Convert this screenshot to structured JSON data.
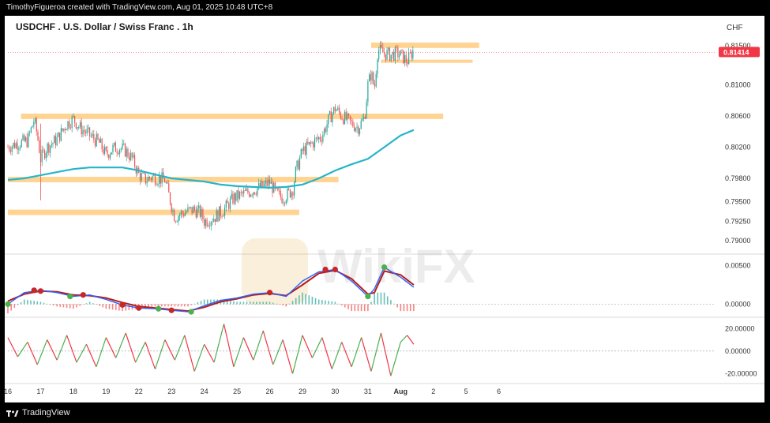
{
  "header": {
    "caption": "TimothyFigueroa created with TradingView.com, Aug 01, 2025 10:48 UTC+8"
  },
  "footer": {
    "brand": "TradingView"
  },
  "watermark": {
    "text": "WikiFX"
  },
  "colors": {
    "background": "#ffffff",
    "up_candle": "#26a69a",
    "down_candle": "#ef5350",
    "ma_line": "#26b5c8",
    "zone_fill": "#ffcc80",
    "price_badge": "#f23645",
    "macd_line": "#2962ff",
    "signal_line": "#b71c1c",
    "macd_cross_up_dot": "#4caf50",
    "macd_cross_down_dot": "#c62828",
    "oscillator_up": "#4caf50",
    "oscillator_down": "#f23645"
  },
  "chart_data": {
    "type": "candlestick",
    "title": "USDCHF . U.S. Dollar / Swiss Franc . 1h",
    "currency": "CHF",
    "last_price": "0.81414",
    "price_axis": {
      "range": [
        0.7885,
        0.8162
      ],
      "ticks": [
        "0.81500",
        "0.81000",
        "0.80600",
        "0.80200",
        "0.79800",
        "0.79500",
        "0.79250",
        "0.79000"
      ]
    },
    "macd_axis": {
      "range": [
        -0.0015,
        0.0065
      ],
      "ticks": [
        "0.00500",
        "0.00000"
      ]
    },
    "oscillator_axis": {
      "range": [
        -26,
        30
      ],
      "ticks": [
        "20.00000",
        "0.00000",
        "-20.00000"
      ]
    },
    "x_axis": {
      "day_range": [
        16,
        37.5
      ],
      "ticks": [
        {
          "label": "16",
          "day": 16
        },
        {
          "label": "17",
          "day": 17
        },
        {
          "label": "18",
          "day": 18
        },
        {
          "label": "19",
          "day": 19
        },
        {
          "label": "22",
          "day": 20
        },
        {
          "label": "23",
          "day": 21
        },
        {
          "label": "24",
          "day": 22
        },
        {
          "label": "25",
          "day": 23
        },
        {
          "label": "26",
          "day": 24
        },
        {
          "label": "29",
          "day": 25
        },
        {
          "label": "30",
          "day": 26
        },
        {
          "label": "31",
          "day": 27
        },
        {
          "label": "Aug",
          "day": 28
        },
        {
          "label": "2",
          "day": 29
        },
        {
          "label": "5",
          "day": 30
        },
        {
          "label": "6",
          "day": 31
        }
      ]
    },
    "price_path": [
      [
        16.0,
        0.802
      ],
      [
        16.3,
        0.8025
      ],
      [
        16.6,
        0.8028
      ],
      [
        16.8,
        0.8055
      ],
      [
        16.9,
        0.8035
      ],
      [
        17.0,
        0.8005
      ],
      [
        17.2,
        0.802
      ],
      [
        17.5,
        0.803
      ],
      [
        17.8,
        0.805
      ],
      [
        18.0,
        0.8056
      ],
      [
        18.2,
        0.8045
      ],
      [
        18.5,
        0.8035
      ],
      [
        18.8,
        0.8025
      ],
      [
        19.0,
        0.801
      ],
      [
        19.2,
        0.8018
      ],
      [
        19.4,
        0.802
      ],
      [
        19.6,
        0.8015
      ],
      [
        19.8,
        0.8005
      ],
      [
        20.0,
        0.7985
      ],
      [
        20.2,
        0.7978
      ],
      [
        20.4,
        0.7982
      ],
      [
        20.6,
        0.798
      ],
      [
        20.8,
        0.7978
      ],
      [
        21.0,
        0.7945
      ],
      [
        21.1,
        0.793
      ],
      [
        21.3,
        0.7935
      ],
      [
        21.5,
        0.7938
      ],
      [
        21.7,
        0.794
      ],
      [
        21.9,
        0.7935
      ],
      [
        22.0,
        0.7925
      ],
      [
        22.3,
        0.793
      ],
      [
        22.6,
        0.794
      ],
      [
        22.9,
        0.7955
      ],
      [
        23.2,
        0.796
      ],
      [
        23.5,
        0.7965
      ],
      [
        23.8,
        0.797
      ],
      [
        24.0,
        0.7975
      ],
      [
        24.2,
        0.796
      ],
      [
        24.4,
        0.7955
      ],
      [
        24.7,
        0.7965
      ],
      [
        24.8,
        0.799
      ],
      [
        25.0,
        0.8015
      ],
      [
        25.3,
        0.8025
      ],
      [
        25.6,
        0.8035
      ],
      [
        25.8,
        0.8055
      ],
      [
        26.0,
        0.807
      ],
      [
        26.2,
        0.806
      ],
      [
        26.5,
        0.805
      ],
      [
        26.7,
        0.8045
      ],
      [
        26.9,
        0.8058
      ],
      [
        27.0,
        0.81
      ],
      [
        27.1,
        0.8115
      ],
      [
        27.2,
        0.8095
      ],
      [
        27.3,
        0.8145
      ],
      [
        27.5,
        0.814
      ],
      [
        27.7,
        0.8138
      ],
      [
        27.9,
        0.814
      ],
      [
        28.0,
        0.8138
      ],
      [
        28.2,
        0.813
      ],
      [
        28.4,
        0.8145
      ]
    ],
    "moving_average": [
      [
        16.0,
        0.7978
      ],
      [
        16.5,
        0.798
      ],
      [
        17.0,
        0.7984
      ],
      [
        17.5,
        0.7988
      ],
      [
        18.0,
        0.7992
      ],
      [
        18.5,
        0.7994
      ],
      [
        19.0,
        0.7994
      ],
      [
        19.5,
        0.7994
      ],
      [
        20.0,
        0.799
      ],
      [
        20.5,
        0.7985
      ],
      [
        21.0,
        0.798
      ],
      [
        21.5,
        0.7978
      ],
      [
        22.0,
        0.7976
      ],
      [
        22.5,
        0.7972
      ],
      [
        23.0,
        0.797
      ],
      [
        23.5,
        0.7969
      ],
      [
        24.0,
        0.7968
      ],
      [
        24.5,
        0.7969
      ],
      [
        25.0,
        0.7972
      ],
      [
        25.5,
        0.798
      ],
      [
        26.0,
        0.799
      ],
      [
        26.5,
        0.7998
      ],
      [
        27.0,
        0.8005
      ],
      [
        27.5,
        0.802
      ],
      [
        28.0,
        0.8035
      ],
      [
        28.4,
        0.8042
      ]
    ],
    "zones": [
      {
        "x_start": 16.4,
        "x_end": 29.3,
        "y_low": 0.8056,
        "y_high": 0.8063
      },
      {
        "x_start": 16.0,
        "x_end": 26.1,
        "y_low": 0.7975,
        "y_high": 0.7982
      },
      {
        "x_start": 16.0,
        "x_end": 24.9,
        "y_low": 0.7933,
        "y_high": 0.794
      },
      {
        "x_start": 27.1,
        "x_end": 30.4,
        "y_low": 0.8147,
        "y_high": 0.8154
      },
      {
        "x_start": 27.4,
        "x_end": 30.2,
        "y_low": 0.8129,
        "y_high": 0.8132
      }
    ],
    "macd": [
      [
        16.0,
        0.0
      ],
      [
        16.5,
        0.0015
      ],
      [
        17.0,
        0.0018
      ],
      [
        17.5,
        0.0015
      ],
      [
        18.0,
        0.001
      ],
      [
        18.5,
        0.0012
      ],
      [
        19.0,
        0.0006
      ],
      [
        19.5,
        -0.0001
      ],
      [
        20.0,
        -0.0005
      ],
      [
        20.5,
        -0.0006
      ],
      [
        21.0,
        -0.0008
      ],
      [
        21.5,
        -0.001
      ],
      [
        22.0,
        -0.0002
      ],
      [
        22.5,
        0.0005
      ],
      [
        23.0,
        0.0008
      ],
      [
        23.5,
        0.0013
      ],
      [
        24.0,
        0.0015
      ],
      [
        24.5,
        0.001
      ],
      [
        25.0,
        0.003
      ],
      [
        25.5,
        0.0042
      ],
      [
        26.0,
        0.0045
      ],
      [
        26.5,
        0.003
      ],
      [
        27.0,
        0.001
      ],
      [
        27.2,
        0.002
      ],
      [
        27.5,
        0.0048
      ],
      [
        28.0,
        0.0035
      ],
      [
        28.4,
        0.0022
      ]
    ],
    "signal": [
      [
        16.0,
        0.0004
      ],
      [
        16.5,
        0.0013
      ],
      [
        17.0,
        0.0017
      ],
      [
        17.5,
        0.0016
      ],
      [
        18.0,
        0.0012
      ],
      [
        18.5,
        0.0011
      ],
      [
        19.0,
        0.0008
      ],
      [
        19.5,
        0.0002
      ],
      [
        20.0,
        -0.0003
      ],
      [
        20.5,
        -0.0005
      ],
      [
        21.0,
        -0.0007
      ],
      [
        21.5,
        -0.0009
      ],
      [
        22.0,
        -0.0004
      ],
      [
        22.5,
        0.0003
      ],
      [
        23.0,
        0.0007
      ],
      [
        23.5,
        0.0012
      ],
      [
        24.0,
        0.0014
      ],
      [
        24.5,
        0.0011
      ],
      [
        25.0,
        0.0025
      ],
      [
        25.5,
        0.004
      ],
      [
        26.0,
        0.0044
      ],
      [
        26.5,
        0.0033
      ],
      [
        27.0,
        0.0013
      ],
      [
        27.2,
        0.0015
      ],
      [
        27.5,
        0.0043
      ],
      [
        28.0,
        0.0038
      ],
      [
        28.4,
        0.0025
      ]
    ],
    "macd_crosses": [
      {
        "x": 16.0,
        "y": 0.0,
        "dir": "up"
      },
      {
        "x": 16.8,
        "y": 0.0018,
        "dir": "down"
      },
      {
        "x": 17.0,
        "y": 0.0017,
        "dir": "down"
      },
      {
        "x": 17.9,
        "y": 0.001,
        "dir": "up"
      },
      {
        "x": 18.3,
        "y": 0.0012,
        "dir": "down"
      },
      {
        "x": 19.5,
        "y": -0.0001,
        "dir": "down"
      },
      {
        "x": 20.0,
        "y": -0.0005,
        "dir": "down"
      },
      {
        "x": 20.6,
        "y": -0.0006,
        "dir": "up"
      },
      {
        "x": 21.0,
        "y": -0.0008,
        "dir": "down"
      },
      {
        "x": 21.6,
        "y": -0.001,
        "dir": "up"
      },
      {
        "x": 24.0,
        "y": 0.0015,
        "dir": "down"
      },
      {
        "x": 25.7,
        "y": 0.0045,
        "dir": "down"
      },
      {
        "x": 26.0,
        "y": 0.0045,
        "dir": "down"
      },
      {
        "x": 27.0,
        "y": 0.001,
        "dir": "up"
      },
      {
        "x": 27.5,
        "y": 0.0048,
        "dir": "up"
      }
    ],
    "oscillator": [
      [
        16.0,
        12
      ],
      [
        16.3,
        -5
      ],
      [
        16.6,
        8
      ],
      [
        16.9,
        -12
      ],
      [
        17.2,
        10
      ],
      [
        17.5,
        -8
      ],
      [
        17.8,
        14
      ],
      [
        18.1,
        -10
      ],
      [
        18.4,
        6
      ],
      [
        18.7,
        -14
      ],
      [
        19.0,
        12
      ],
      [
        19.3,
        -6
      ],
      [
        19.6,
        16
      ],
      [
        19.9,
        -10
      ],
      [
        20.2,
        8
      ],
      [
        20.5,
        -16
      ],
      [
        20.8,
        10
      ],
      [
        21.1,
        -8
      ],
      [
        21.4,
        14
      ],
      [
        21.7,
        -18
      ],
      [
        22.0,
        6
      ],
      [
        22.3,
        -10
      ],
      [
        22.6,
        24
      ],
      [
        22.9,
        -14
      ],
      [
        23.2,
        12
      ],
      [
        23.5,
        -8
      ],
      [
        23.8,
        18
      ],
      [
        24.1,
        -12
      ],
      [
        24.4,
        10
      ],
      [
        24.7,
        -20
      ],
      [
        25.0,
        14
      ],
      [
        25.3,
        -6
      ],
      [
        25.6,
        12
      ],
      [
        25.9,
        -16
      ],
      [
        26.2,
        8
      ],
      [
        26.5,
        -14
      ],
      [
        26.8,
        12
      ],
      [
        27.1,
        -18
      ],
      [
        27.4,
        16
      ],
      [
        27.7,
        -22
      ],
      [
        28.0,
        8
      ],
      [
        28.2,
        14
      ],
      [
        28.4,
        6
      ]
    ]
  }
}
